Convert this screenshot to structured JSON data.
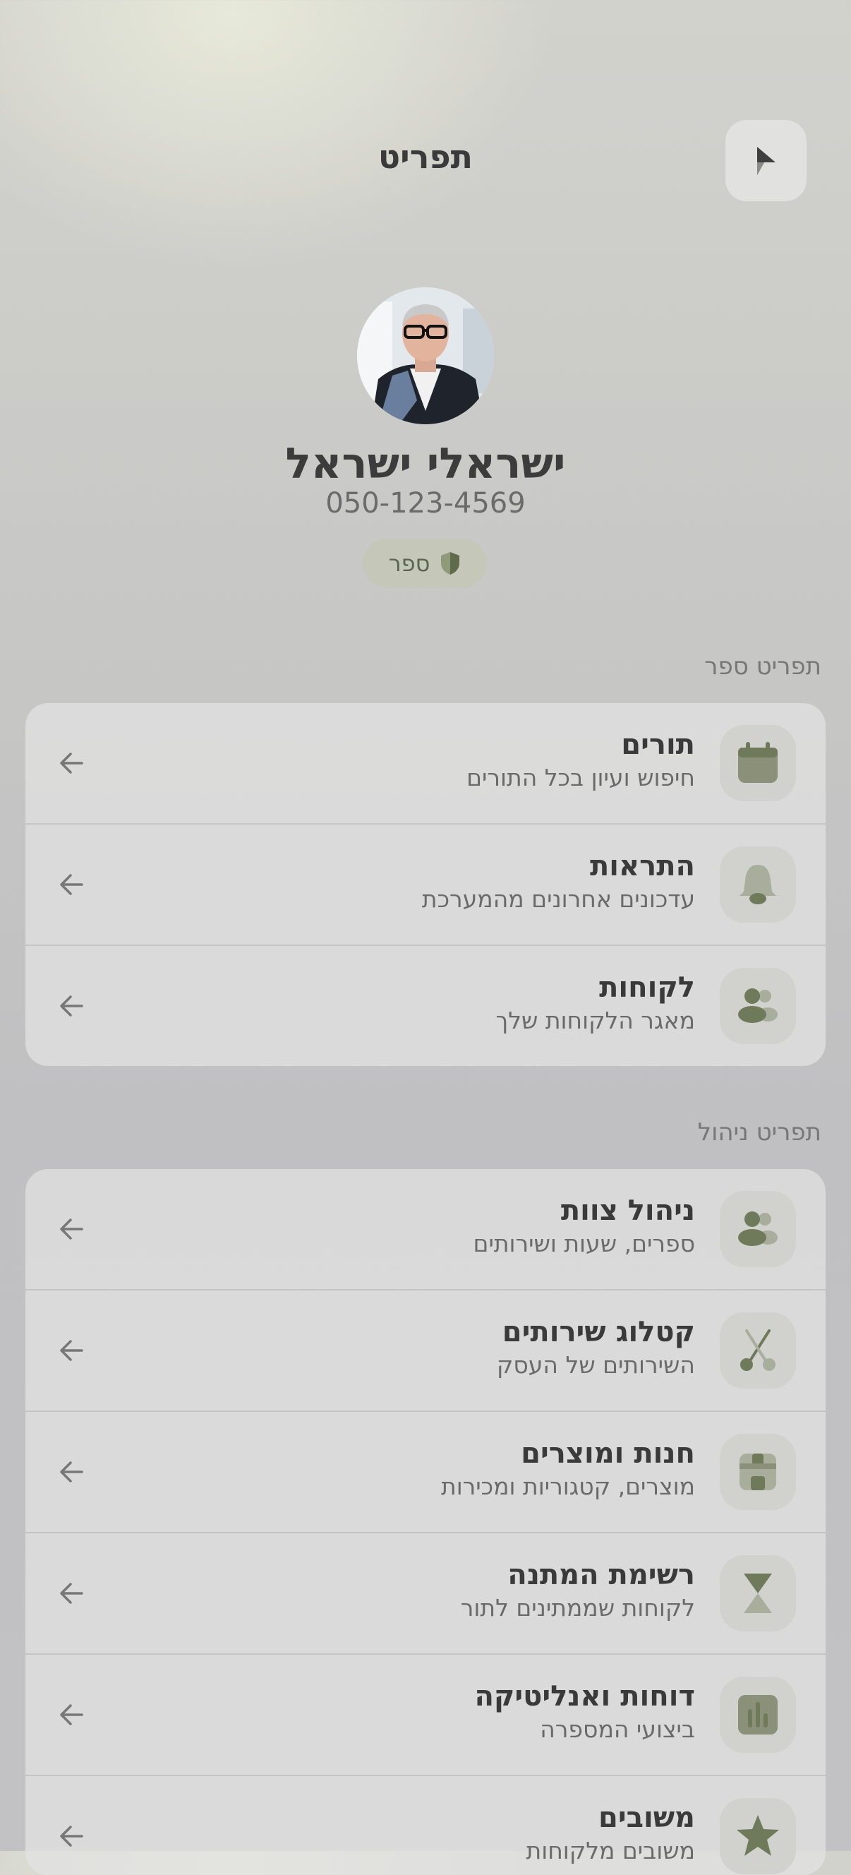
{
  "header": {
    "title": "תפריט"
  },
  "profile": {
    "name": "ישראלי ישראל",
    "phone": "050-123-4569",
    "role": "ספר"
  },
  "colors": {
    "accent": "#6f7a5a",
    "icon_bg": "#d1d1ce"
  },
  "sections": [
    {
      "title": "תפריט ספר",
      "items": [
        {
          "title": "תורים",
          "subtitle": "חיפוש ועיון בכל התורים",
          "icon": "calendar-icon"
        },
        {
          "title": "התראות",
          "subtitle": "עדכונים אחרונים מהמערכת",
          "icon": "bell-icon"
        },
        {
          "title": "לקוחות",
          "subtitle": "מאגר הלקוחות שלך",
          "icon": "users-icon"
        }
      ]
    },
    {
      "title": "תפריט ניהול",
      "items": [
        {
          "title": "ניהול צוות",
          "subtitle": "ספרים, שעות ושירותים",
          "icon": "team-icon"
        },
        {
          "title": "קטלוג שירותים",
          "subtitle": "השירותים של העסק",
          "icon": "scissors-icon"
        },
        {
          "title": "חנות ומוצרים",
          "subtitle": "מוצרים, קטגוריות ומכירות",
          "icon": "store-icon"
        },
        {
          "title": "רשימת המתנה",
          "subtitle": "לקוחות שממתינים לתור",
          "icon": "hourglass-icon"
        },
        {
          "title": "דוחות ואנליטיקה",
          "subtitle": "ביצועי המספרה",
          "icon": "chart-icon"
        },
        {
          "title": "משובים",
          "subtitle": "משובים מלקוחות",
          "icon": "star-icon"
        }
      ]
    }
  ]
}
